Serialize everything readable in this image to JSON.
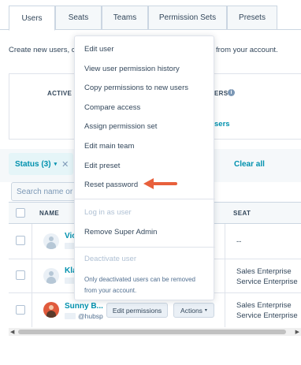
{
  "tabs": [
    {
      "label": "Users",
      "active": true
    },
    {
      "label": "Seats",
      "active": false
    },
    {
      "label": "Teams",
      "active": false
    },
    {
      "label": "Permission Sets",
      "active": false
    },
    {
      "label": "Presets",
      "active": false
    }
  ],
  "intro": {
    "left": "Create new users, cu",
    "right": "from your account."
  },
  "stats": {
    "active_label": "ACTIVE U",
    "right_label": "ERS",
    "users_link": "sers"
  },
  "filter": {
    "status_chip": "Status (3)",
    "clear_all": "Clear all"
  },
  "search": {
    "placeholder": "Search name or"
  },
  "table": {
    "headers": {
      "name": "NAME",
      "seat": "SEAT"
    },
    "rows": [
      {
        "name": "Vic",
        "email": "",
        "seat_1": "--",
        "seat_2": ""
      },
      {
        "name": "Kla",
        "email": "",
        "seat_1": "Sales Enterprise",
        "seat_2": "Service Enterprise"
      },
      {
        "name": "Sunny B...",
        "email": "@hubsp",
        "seat_1": "Sales Enterprise",
        "seat_2": "Service Enterprise"
      }
    ],
    "edit_permissions": "Edit permissions",
    "actions": "Actions"
  },
  "menu": {
    "items": [
      "Edit user",
      "View user permission history",
      "Copy permissions to new users",
      "Compare access",
      "Assign permission set",
      "Edit main team",
      "Edit preset",
      "Reset password",
      "Log in as user",
      "Remove Super Admin",
      "Deactivate user"
    ],
    "note_line1": "Only deactivated users can be removed",
    "note_line2": "from your account."
  },
  "colors": {
    "accent": "#0091ae",
    "pointer_arrow": "#e8603c",
    "text": "#33475b",
    "border": "#cbd6e2"
  },
  "icons": {
    "info": "info-icon",
    "chevron": "chevron-down-icon",
    "close": "close-icon",
    "arrow": "arrow-pointer-icon"
  }
}
